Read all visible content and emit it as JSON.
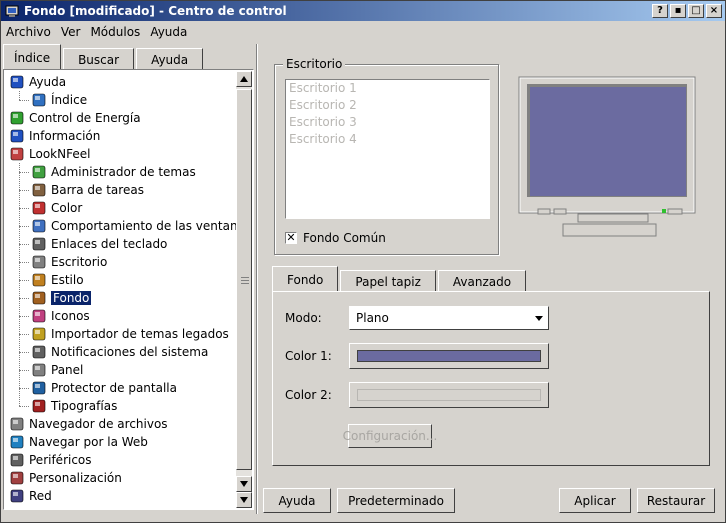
{
  "window": {
    "title": "Fondo [modificado] - Centro de control",
    "buttons": [
      "?",
      "▪",
      "□",
      "×"
    ]
  },
  "menubar": [
    {
      "label": "Archivo"
    },
    {
      "label": "Ver"
    },
    {
      "label": "Módulos"
    },
    {
      "label": "Ayuda"
    }
  ],
  "left_tabs": [
    {
      "label": "Índice",
      "active": true
    },
    {
      "label": "Buscar",
      "active": false
    },
    {
      "label": "Ayuda",
      "active": false
    }
  ],
  "tree": [
    {
      "label": "Ayuda",
      "level": 0,
      "icon": "help-icon"
    },
    {
      "label": "Índice",
      "level": 1,
      "icon": "index-icon"
    },
    {
      "label": "Control de Energía",
      "level": 0,
      "icon": "power-icon"
    },
    {
      "label": "Información",
      "level": 0,
      "icon": "info-icon"
    },
    {
      "label": "LookNFeel",
      "level": 0,
      "icon": "looknfeel-icon"
    },
    {
      "label": "Administrador de temas",
      "level": 1,
      "icon": "themes-icon"
    },
    {
      "label": "Barra de tareas",
      "level": 1,
      "icon": "taskbar-icon"
    },
    {
      "label": "Color",
      "level": 1,
      "icon": "color-icon"
    },
    {
      "label": "Comportamiento de las ventanas",
      "level": 1,
      "icon": "window-behavior-icon"
    },
    {
      "label": "Enlaces del teclado",
      "level": 1,
      "icon": "keyboard-icon"
    },
    {
      "label": "Escritorio",
      "level": 1,
      "icon": "desktop-icon"
    },
    {
      "label": "Estilo",
      "level": 1,
      "icon": "style-icon"
    },
    {
      "label": "Fondo",
      "level": 1,
      "icon": "background-icon",
      "selected": true
    },
    {
      "label": "Iconos",
      "level": 1,
      "icon": "icons-icon"
    },
    {
      "label": "Importador de temas legados",
      "level": 1,
      "icon": "theme-import-icon"
    },
    {
      "label": "Notificaciones del sistema",
      "level": 1,
      "icon": "notifications-icon"
    },
    {
      "label": "Panel",
      "level": 1,
      "icon": "panel-icon"
    },
    {
      "label": "Protector de pantalla",
      "level": 1,
      "icon": "screensaver-icon"
    },
    {
      "label": "Tipografías",
      "level": 1,
      "icon": "fonts-icon"
    },
    {
      "label": "Navegador de archivos",
      "level": 0,
      "icon": "file-browser-icon"
    },
    {
      "label": "Navegar por la Web",
      "level": 0,
      "icon": "web-icon"
    },
    {
      "label": "Periféricos",
      "level": 0,
      "icon": "peripherals-icon"
    },
    {
      "label": "Personalización",
      "level": 0,
      "icon": "personalization-icon"
    },
    {
      "label": "Red",
      "level": 0,
      "icon": "network-icon"
    }
  ],
  "desktop_group": {
    "title": "Escritorio",
    "items": [
      "Escritorio 1",
      "Escritorio 2",
      "Escritorio 3",
      "Escritorio 4"
    ],
    "common_checkbox": {
      "label": "Fondo Común",
      "checked": true
    }
  },
  "monitor": {
    "screen_color": "#6b6ba0"
  },
  "right_tabs": [
    {
      "label": "Fondo",
      "active": true
    },
    {
      "label": "Papel tapiz",
      "active": false
    },
    {
      "label": "Avanzado",
      "active": false
    }
  ],
  "fondo": {
    "mode_label": "Modo:",
    "mode_value": "Plano",
    "color1_label": "Color 1:",
    "color1": "#6b6ba0",
    "color2_label": "Color 2:",
    "color2": "#d6d3ce",
    "config_button": "Configuración..."
  },
  "bottom_buttons": {
    "help": "Ayuda",
    "default": "Predeterminado",
    "apply": "Aplicar",
    "reset": "Restaurar"
  }
}
